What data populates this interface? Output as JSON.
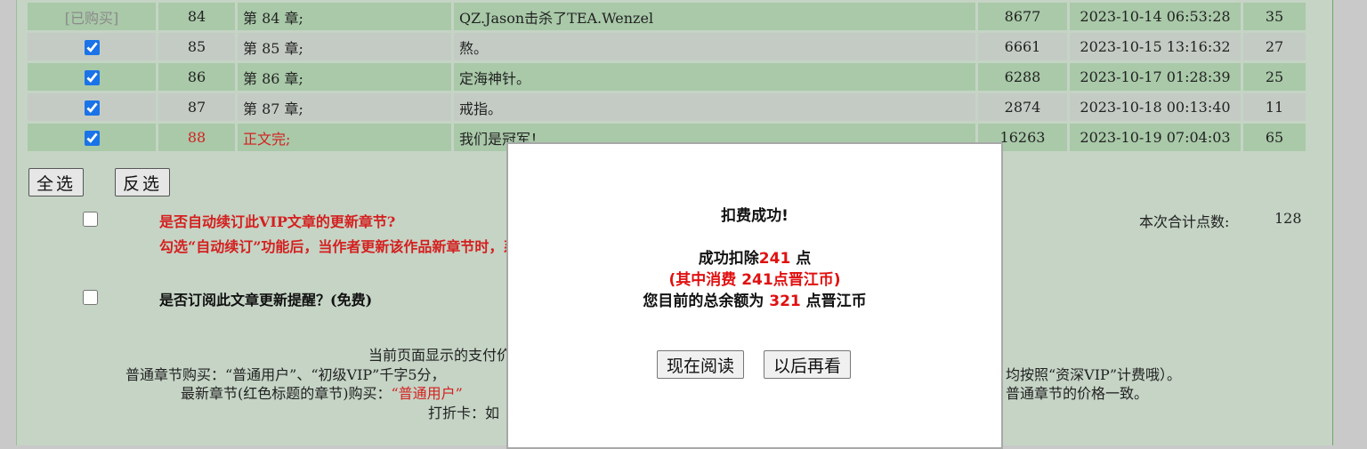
{
  "chapters": [
    {
      "check": "[已购买]",
      "num": "84",
      "title": "第 84 章;",
      "summary": "QZ.Jason击杀了TEA.Wenzel",
      "words": "8677",
      "date": "2023-10-14 06:53:28",
      "count": "35",
      "bought": true,
      "style": "green"
    },
    {
      "num": "85",
      "title": "第 85 章;",
      "summary": "熬。",
      "words": "6661",
      "date": "2023-10-15 13:16:32",
      "count": "27",
      "checked": true,
      "style": "gray"
    },
    {
      "num": "86",
      "title": "第 86 章;",
      "summary": "定海神针。",
      "words": "6288",
      "date": "2023-10-17 01:28:39",
      "count": "25",
      "checked": true,
      "style": "green"
    },
    {
      "num": "87",
      "title": "第 87 章;",
      "summary": "戒指。",
      "words": "2874",
      "date": "2023-10-18 00:13:40",
      "count": "11",
      "checked": true,
      "style": "gray"
    },
    {
      "num": "88",
      "title": "正文完;",
      "summary": "我们是冠军！",
      "words": "16263",
      "date": "2023-10-19 07:04:03",
      "count": "65",
      "checked": true,
      "style": "green",
      "latest": true
    }
  ],
  "buttons": {
    "select_all": "全选",
    "invert": "反选"
  },
  "auto_renew": {
    "question": "是否自动续订此VIP文章的更新章节?",
    "description": "勾选“自动续订”功能后，当作者更新该作品新章节时，系统将自动为您购买，您可以直接阅读，不需要再进行人工购买付费的操作。"
  },
  "subscribe": {
    "question": "是否订阅此文章更新提醒？(免费)"
  },
  "total": {
    "label": "本次合计点数:",
    "value": "128"
  },
  "notes": {
    "line1": "当前页面显示的支付价格为",
    "line2_a": "普通章节购买：“普通用户”、“初级VIP”千字5分，",
    "line2_b": "均按照“资深VIP”计费哦）。",
    "line3_a": "最新章节(红色标题的章节)购买：",
    "line3_red": "“普通用户”",
    "line3_b": "普通章节的价格一致。",
    "line4": "打折卡：如"
  },
  "modal": {
    "title": "扣费成功!",
    "deduct_prefix": "成功扣除",
    "deduct_amount": "241",
    "deduct_suffix": " 点",
    "detail": "(其中消费 241点晋江币)",
    "balance_prefix": "您目前的总余额为 ",
    "balance_amount": "321",
    "balance_suffix": " 点晋江币",
    "read_now": "现在阅读",
    "later": "以后再看"
  }
}
